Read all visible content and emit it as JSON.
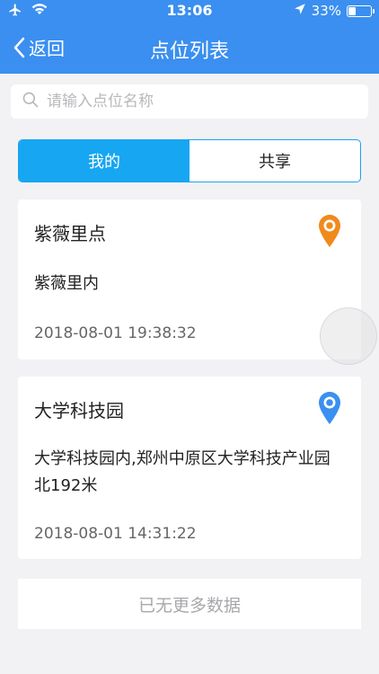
{
  "status_bar": {
    "time": "13:06",
    "battery_percent": "33%",
    "battery_level": 0.33,
    "icons": [
      "airplane-icon",
      "wifi-icon",
      "location-arrow-icon",
      "battery-icon"
    ]
  },
  "nav": {
    "back_label": "返回",
    "title": "点位列表"
  },
  "search": {
    "placeholder": "请输入点位名称",
    "value": ""
  },
  "tabs": [
    {
      "label": "我的",
      "active": true
    },
    {
      "label": "共享",
      "active": false
    }
  ],
  "points": [
    {
      "name": "紫薇里点",
      "address": "紫薇里内",
      "time": "2018-08-01 19:38:32",
      "pin_icon": "location-pin-orange-icon",
      "pin_color": "#f08a1c"
    },
    {
      "name": "大学科技园",
      "address": "大学科技园内,郑州中原区大学科技产业园北192米",
      "time": "2018-08-01 14:31:22",
      "pin_icon": "location-pin-blue-icon",
      "pin_color": "#3a8ff0"
    }
  ],
  "footer": {
    "no_more_label": "已无更多数据"
  },
  "colors": {
    "nav_bg": "#3a8ff0",
    "tab_active": "#17a6f2",
    "page_bg": "#f2f2f4"
  }
}
